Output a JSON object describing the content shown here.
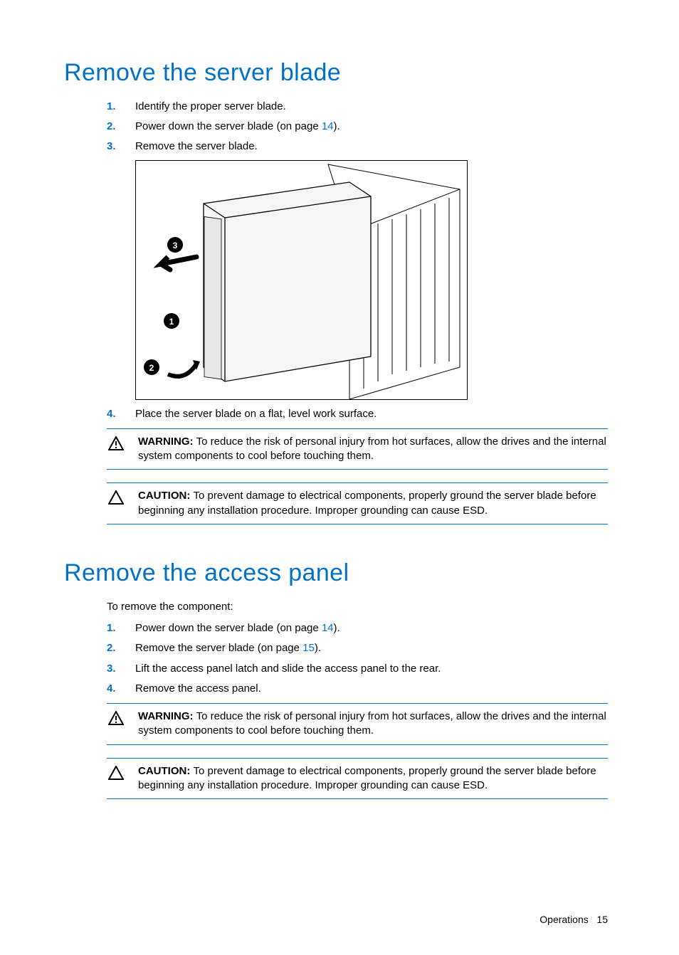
{
  "section1": {
    "heading": "Remove the server blade",
    "steps": [
      {
        "num": "1.",
        "text": "Identify the proper server blade."
      },
      {
        "num": "2.",
        "prefix": "Power down the server blade (on page ",
        "link": "14",
        "suffix": ")."
      },
      {
        "num": "3.",
        "text": "Remove the server blade."
      },
      {
        "num": "4.",
        "text": "Place the server blade on a flat, level work surface."
      }
    ],
    "warning": {
      "label": "WARNING:",
      "text": "To reduce the risk of personal injury from hot surfaces, allow the drives and the internal system components to cool before touching them."
    },
    "caution": {
      "label": "CAUTION:",
      "text": "To prevent damage to electrical components, properly ground the server blade before beginning any installation procedure. Improper grounding can cause ESD."
    }
  },
  "section2": {
    "heading": "Remove the access panel",
    "intro": "To remove the component:",
    "steps": [
      {
        "num": "1.",
        "prefix": "Power down the server blade (on page ",
        "link": "14",
        "suffix": ")."
      },
      {
        "num": "2.",
        "prefix": "Remove the server blade (on page ",
        "link": "15",
        "suffix": ")."
      },
      {
        "num": "3.",
        "text": "Lift the access panel latch and slide the access panel to the rear."
      },
      {
        "num": "4.",
        "text": "Remove the access panel."
      }
    ],
    "warning": {
      "label": "WARNING:",
      "text": "To reduce the risk of personal injury from hot surfaces, allow the drives and the internal system components to cool before touching them."
    },
    "caution": {
      "label": "CAUTION:",
      "text": "To prevent damage to electrical components, properly ground the server blade before beginning any installation procedure. Improper grounding can cause ESD."
    }
  },
  "footer": {
    "section": "Operations",
    "page": "15"
  }
}
